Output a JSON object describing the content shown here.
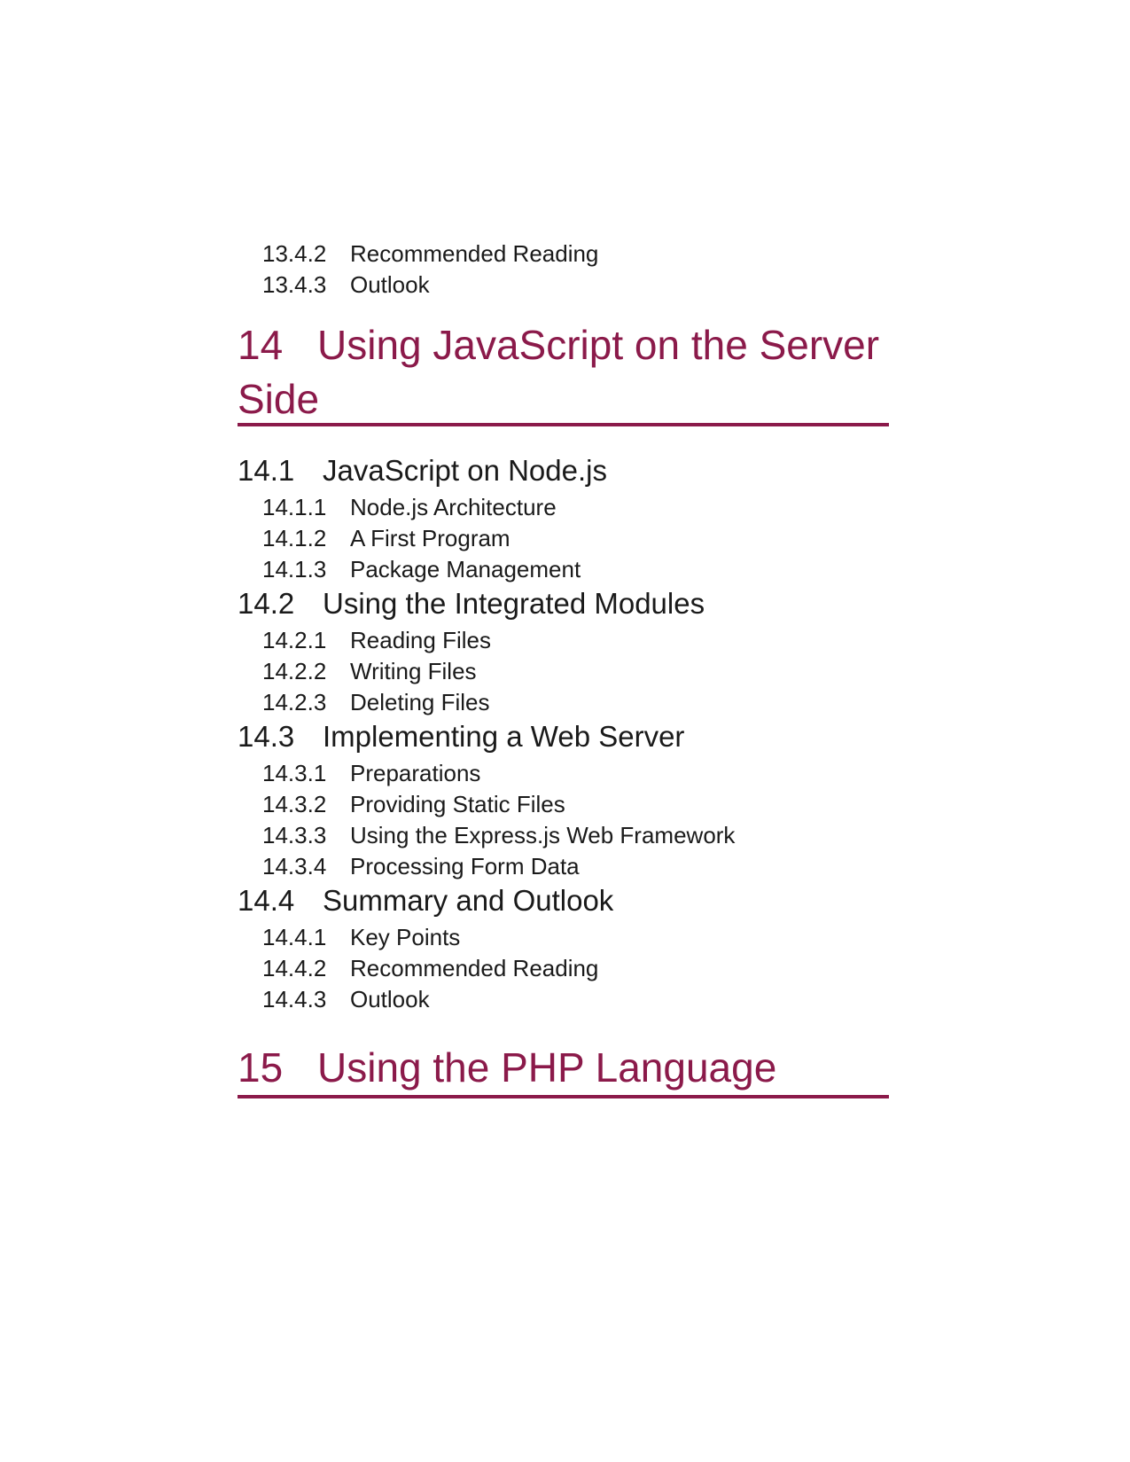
{
  "toc": {
    "pre_items": [
      {
        "num": "13.4.2",
        "title": "Recommended Reading"
      },
      {
        "num": "13.4.3",
        "title": "Outlook"
      }
    ],
    "chapter14": {
      "num": "14",
      "title": "Using JavaScript on the Server Side",
      "sections": [
        {
          "num": "14.1",
          "title": "JavaScript on Node.js",
          "items": [
            {
              "num": "14.1.1",
              "title": "Node.js Architecture"
            },
            {
              "num": "14.1.2",
              "title": "A First Program"
            },
            {
              "num": "14.1.3",
              "title": "Package Management"
            }
          ]
        },
        {
          "num": "14.2",
          "title": "Using the Integrated Modules",
          "items": [
            {
              "num": "14.2.1",
              "title": "Reading Files"
            },
            {
              "num": "14.2.2",
              "title": "Writing Files"
            },
            {
              "num": "14.2.3",
              "title": "Deleting Files"
            }
          ]
        },
        {
          "num": "14.3",
          "title": "Implementing a Web Server",
          "items": [
            {
              "num": "14.3.1",
              "title": "Preparations"
            },
            {
              "num": "14.3.2",
              "title": "Providing Static Files"
            },
            {
              "num": "14.3.3",
              "title": "Using the Express.js Web Framework"
            },
            {
              "num": "14.3.4",
              "title": "Processing Form Data"
            }
          ]
        },
        {
          "num": "14.4",
          "title": "Summary and Outlook",
          "items": [
            {
              "num": "14.4.1",
              "title": "Key Points"
            },
            {
              "num": "14.4.2",
              "title": "Recommended Reading"
            },
            {
              "num": "14.4.3",
              "title": "Outlook"
            }
          ]
        }
      ]
    },
    "chapter15": {
      "num": "15",
      "title": "Using the PHP Language"
    },
    "accent_color": "#8b1a4a"
  }
}
